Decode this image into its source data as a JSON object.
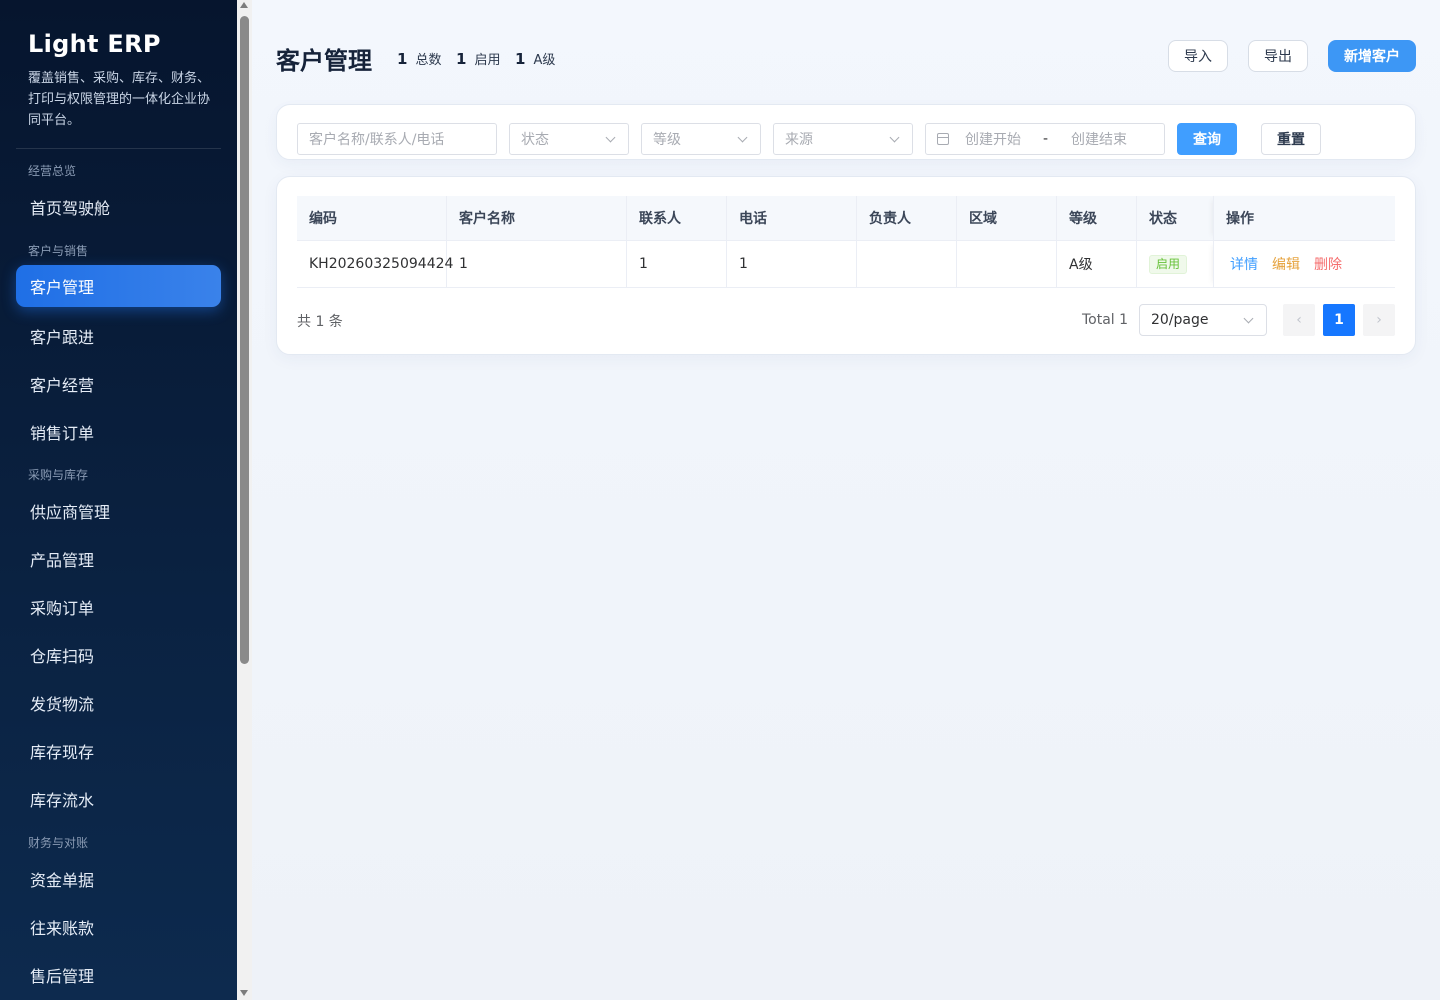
{
  "app": {
    "title": "Light ERP",
    "description": "覆盖销售、采购、库存、财务、打印与权限管理的一体化企业协同平台。"
  },
  "sidebar": {
    "groups": [
      {
        "label": "经营总览"
      },
      {
        "label": "客户与销售"
      },
      {
        "label": "采购与库存"
      },
      {
        "label": "财务与对账"
      }
    ],
    "items": [
      {
        "label": "首页驾驶舱"
      },
      {
        "label": "客户管理",
        "active": true
      },
      {
        "label": "客户跟进"
      },
      {
        "label": "客户经营"
      },
      {
        "label": "销售订单"
      },
      {
        "label": "供应商管理"
      },
      {
        "label": "产品管理"
      },
      {
        "label": "采购订单"
      },
      {
        "label": "仓库扫码"
      },
      {
        "label": "发货物流"
      },
      {
        "label": "库存现存"
      },
      {
        "label": "库存流水"
      },
      {
        "label": "资金单据"
      },
      {
        "label": "往来账款"
      },
      {
        "label": "售后管理"
      }
    ]
  },
  "header": {
    "title": "客户管理",
    "stats": [
      {
        "value": "1",
        "label": "总数"
      },
      {
        "value": "1",
        "label": "启用"
      },
      {
        "value": "1",
        "label": "A级"
      }
    ],
    "import_label": "导入",
    "export_label": "导出",
    "add_label": "新增客户"
  },
  "filters": {
    "keyword_placeholder": "客户名称/联系人/电话",
    "status_placeholder": "状态",
    "level_placeholder": "等级",
    "source_placeholder": "来源",
    "date_start_placeholder": "创建开始",
    "date_separator": "-",
    "date_end_placeholder": "创建结束",
    "query_label": "查询",
    "reset_label": "重置"
  },
  "table": {
    "columns": [
      "编码",
      "客户名称",
      "联系人",
      "电话",
      "负责人",
      "区域",
      "等级",
      "状态",
      "操作"
    ],
    "rows": [
      {
        "code": "KH20260325094424",
        "name": "1",
        "contact": "1",
        "phone": "1",
        "owner": "",
        "region": "",
        "level": "A级",
        "status": "启用"
      }
    ],
    "actions": {
      "detail": "详情",
      "edit": "编辑",
      "delete": "删除"
    }
  },
  "pagination": {
    "count_text": "共 1 条",
    "total_text": "Total 1",
    "page_size": "20/page",
    "current_page": "1",
    "prev_glyph": "‹",
    "next_glyph": "›"
  },
  "colors": {
    "primary": "#409eff",
    "sidebar_active": "#1f6fe6",
    "success": "#67c23a",
    "warning": "#e6a23c",
    "danger": "#f56c6c"
  }
}
